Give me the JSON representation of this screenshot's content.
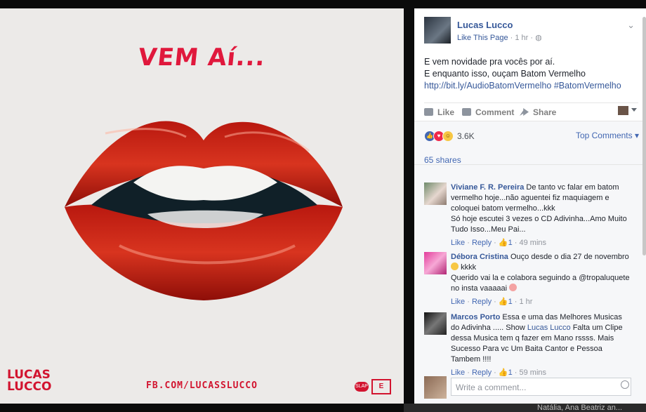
{
  "image": {
    "headline": "VEM Aí...",
    "brand_line1": "LUCAS",
    "brand_line2": "LUCCO",
    "fb_url": "FB.COM/LUCASSLUCCO",
    "label_badge": "SLAP",
    "label_mark": "E"
  },
  "post": {
    "page_name": "Lucas Lucco",
    "like_page": "Like This Page",
    "time": "· 1 hr ·",
    "text_line1": "E vem novidade pra vocês por aí.",
    "text_line2": "E enquanto isso, ouçam Batom Vermelho",
    "link": "http://bit.ly/AudioBatomVermelho #BatomVermelho"
  },
  "actions": {
    "like": "Like",
    "comment": "Comment",
    "share": "Share"
  },
  "stats": {
    "reactions_count": "3.6K",
    "sort_label": "Top Comments",
    "shares": "65 shares"
  },
  "comments": [
    {
      "name": "Viviane F. R. Pereira",
      "text": "De tanto vc falar em batom vermelho hoje...não aguentei fiz maquiagem e coloquei batom vermelho...kkk",
      "text2": "Só hoje escutei 3 vezes o CD Adivinha...Amo Muito Tudo Isso...Meu Pai...",
      "like": "Like",
      "reply": "Reply",
      "likes": "1",
      "time": "49 mins"
    },
    {
      "name": "Débora Cristina",
      "text": "Ouço desde o dia 27 de novembro",
      "text_after_emoji": "kkkk",
      "text2": "Querido vai la e colabora seguindo a @tropaluquete no insta vaaaaai",
      "like": "Like",
      "reply": "Reply",
      "likes": "1",
      "time": "1 hr"
    },
    {
      "name": "Marcos Porto",
      "text": "Essa e uma das Melhores Musicas do Adivinha ..... Show",
      "mention": "Lucas Lucco",
      "text_after_mention": "Falta um Clipe dessa Musica tem q fazer em Mano rssss. Mais Sucesso Para vc Um Baita Cantor e Pessoa Tambem !!!!",
      "like": "Like",
      "reply": "Reply",
      "likes": "1",
      "time": "59 mins"
    }
  ],
  "compose": {
    "placeholder": "Write a comment..."
  },
  "footer": {
    "names": "Natália, Ana Beatriz an..."
  },
  "colors": {
    "link": "#365899",
    "accent_red": "#d2142f",
    "like_blue": "#4267b2"
  }
}
